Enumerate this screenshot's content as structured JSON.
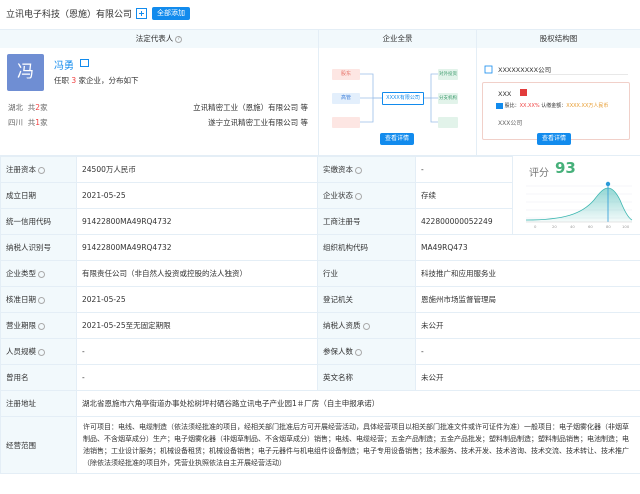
{
  "header": {
    "company": "立讯电子科技（恩施）有限公司",
    "add_all": "全部添加"
  },
  "columns": {
    "legal_rep": "法定代表人",
    "overview": "企业全景",
    "equity": "股权结构图"
  },
  "person": {
    "avatar_char": "冯",
    "name": "冯勇",
    "sub_prefix": "任职 ",
    "sub_count": "3",
    "sub_suffix": " 家企业，分布如下",
    "regions": [
      {
        "name": "湖北",
        "prefix": "共",
        "count": "2",
        "unit": "家",
        "company": "立讯精密工业（恩施）有限公司 等"
      },
      {
        "name": "四川",
        "prefix": "共",
        "count": "1",
        "unit": "家",
        "company": "遂宁立讯精密工业有限公司 等"
      }
    ]
  },
  "overview": {
    "nodes": {
      "shareholder": "股东",
      "executive": "高管",
      "main": "XXXX有限公司",
      "investment": "对外投资",
      "branch": "分支机构",
      "history": "历史信息"
    },
    "view_btn": "查看详情"
  },
  "equity": {
    "company": "XXXXXXXXX公司",
    "holder": "XXX",
    "ratio_label": "股比：",
    "ratio_value": "XX.XX%",
    "capital_label": "认缴金额：",
    "capital_value": "XXXX.XX万人民币",
    "holder2": "XXX公司",
    "view_btn": "查看详情"
  },
  "score": {
    "label": "评分",
    "value": "93",
    "ticks": [
      "0",
      "20",
      "40",
      "60",
      "80",
      "100"
    ],
    "axis_label": "100"
  },
  "rows": [
    {
      "l1": "注册资本",
      "v1": "24500万人民币",
      "l2": "实缴资本",
      "v2": "-"
    },
    {
      "l1": "成立日期",
      "v1": "2021-05-25",
      "l2": "企业状态",
      "v2": "存续"
    },
    {
      "l1": "统一信用代码",
      "v1": "91422800MA49RQ4732",
      "l2": "工商注册号",
      "v2": "422800000052249"
    },
    {
      "l1": "纳税人识别号",
      "v1": "91422800MA49RQ4732",
      "l2": "组织机构代码",
      "v2": "MA49RQ473"
    },
    {
      "l1": "企业类型",
      "v1": "有限责任公司（非自然人投资或控股的法人独资）",
      "l2": "行业",
      "v2": "科技推广和应用服务业"
    },
    {
      "l1": "核准日期",
      "v1": "2021-05-25",
      "l2": "登记机关",
      "v2": "恩施州市场监督管理局"
    },
    {
      "l1": "营业期限",
      "v1": "2021-05-25至无固定期限",
      "l2": "纳税人资质",
      "v2": "未公开"
    },
    {
      "l1": "人员规模",
      "v1": "-",
      "l2": "参保人数",
      "v2": "-"
    },
    {
      "l1": "曾用名",
      "v1": "-",
      "l2": "英文名称",
      "v2": "未公开"
    }
  ],
  "address": {
    "label": "注册地址",
    "value": "湖北省恩施市六角亭街道办事处松树坪村硒谷路立讯电子产业园1＃厂房（自主申报承诺）"
  },
  "scope": {
    "label": "经营范围",
    "value": "许可项目：电线、电缆制造（依法须经批准的项目，经相关部门批准后方可开展经营活动，具体经营项目以相关部门批准文件或许可证件为准）一般项目：电子烟雾化器（非烟草制品、不含烟草成分）生产；电子烟雾化器（非烟草制品、不含烟草成分）销售；电线、电缆经营；五金产品制造；五金产品批发；塑料制品制造；塑料制品销售；电池制造；电池销售；工业设计服务；机械设备租赁；机械设备销售；电子元器件与机电组件设备制造；电子专用设备销售；技术服务、技术开发、技术咨询、技术交流、技术转让、技术推广（除依法须经批准的项目外，凭营业执照依法自主开展经营活动）"
  },
  "colors": {
    "accent": "#128bed",
    "label_bg": "#f2f9fc",
    "border": "#e4eef6",
    "score_green": "#46b07a",
    "red": "#f04040"
  }
}
